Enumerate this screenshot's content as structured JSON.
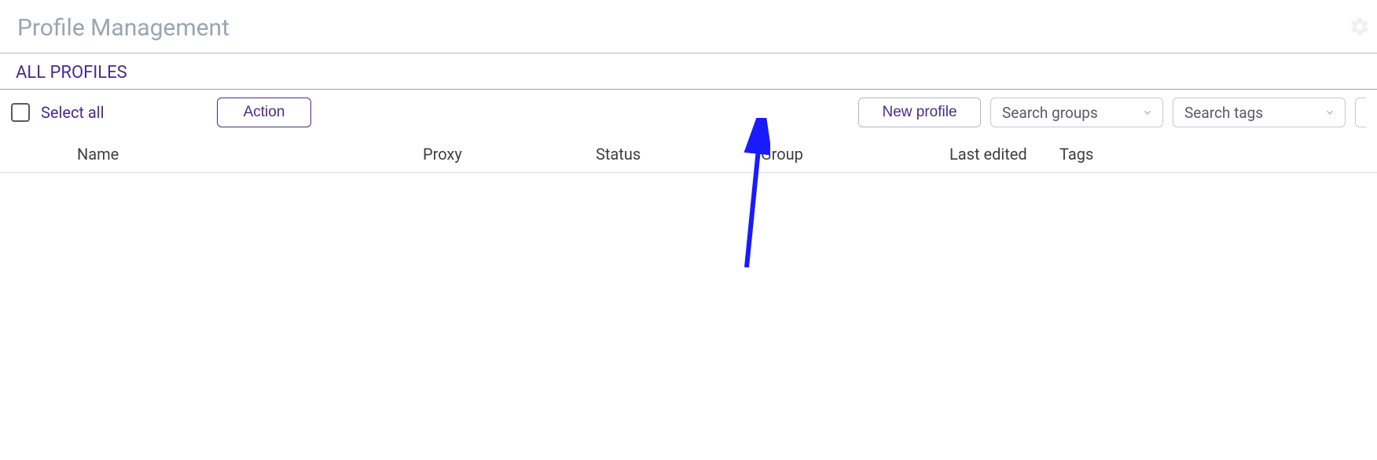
{
  "header": {
    "title": "Profile Management"
  },
  "sub_header": "ALL PROFILES",
  "toolbar": {
    "select_all_label": "Select all",
    "action_label": "Action",
    "new_profile_label": "New profile",
    "search_groups_placeholder": "Search groups",
    "search_tags_placeholder": "Search tags"
  },
  "columns": {
    "name": "Name",
    "proxy": "Proxy",
    "status": "Status",
    "group": "Group",
    "last_edited": "Last edited",
    "tags": "Tags"
  },
  "rows": [],
  "annotation": {
    "arrow_color": "#1a1aff",
    "target": "new-profile-button"
  }
}
